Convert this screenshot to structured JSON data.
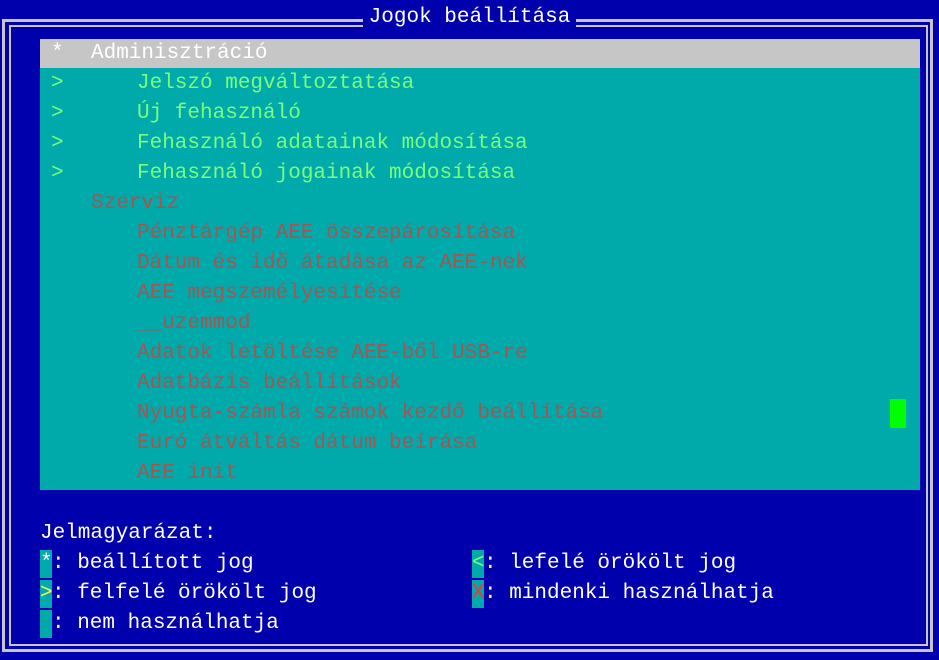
{
  "window": {
    "title": "Jogok beállítása"
  },
  "list": {
    "items": [
      {
        "marker": "*",
        "label": "Adminisztráció",
        "selected": true
      },
      {
        "marker": ">",
        "label": "Jelszó megváltoztatása"
      },
      {
        "marker": ">",
        "label": "Új fehasználó"
      },
      {
        "marker": ">",
        "label": "Fehasználó adatainak módosítása"
      },
      {
        "marker": ">",
        "label": "Fehasználó jogainak módosítása"
      },
      {
        "marker": "",
        "label": "Szerviz"
      },
      {
        "marker": "",
        "label": "Pénztárgép AEE összepárosítása"
      },
      {
        "marker": "",
        "label": "Dátum és idő átadása az AEE-nek"
      },
      {
        "marker": "",
        "label": "AEE megszemélyesítése"
      },
      {
        "marker": "",
        "label": "__uzemmod"
      },
      {
        "marker": "",
        "label": "Adatok letöltése AEE-ből USB-re"
      },
      {
        "marker": "",
        "label": "Adatbázis beállítások"
      },
      {
        "marker": "",
        "label": "Nyugta-számla számok kezdő beállítása"
      },
      {
        "marker": "",
        "label": "Euró átváltás dátum beírása"
      },
      {
        "marker": "",
        "label": "AEE init"
      }
    ]
  },
  "legend": {
    "title": "Jelmagyarázat:",
    "entries": [
      {
        "symbol": "*",
        "text": ": beállított jog"
      },
      {
        "symbol": "<",
        "text": ": lefelé örökölt jog"
      },
      {
        "symbol": ">",
        "text": ": felfelé örökölt jog"
      },
      {
        "symbol": "X",
        "text": ": mindenki használhatja"
      },
      {
        "symbol": "",
        "text": ": nem használhatja"
      }
    ]
  },
  "colors": {
    "background": "#0000ad",
    "panel": "#00aaaa",
    "selected_row": "#c6c6c6",
    "inherited_text": "#7cfc7c",
    "unset_text": "#a85450",
    "cursor": "#00ff00"
  }
}
